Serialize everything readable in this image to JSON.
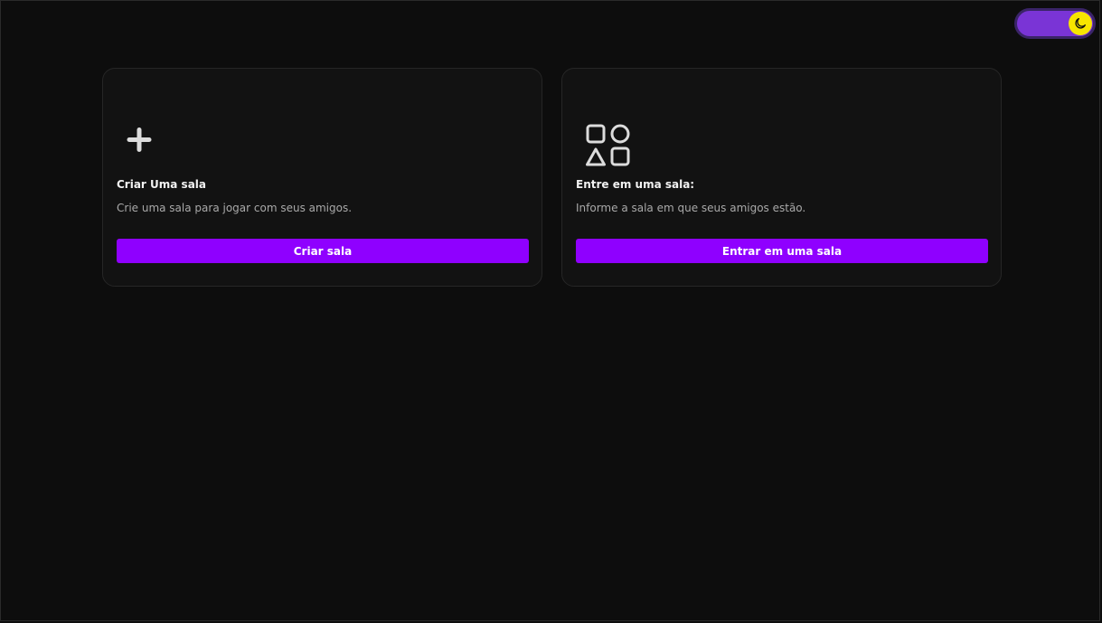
{
  "theme_toggle": {
    "icon": "moon-icon",
    "state": "dark",
    "track_color": "#7a34d6",
    "knob_color": "#f7e500"
  },
  "cards": [
    {
      "icon": "plus-icon",
      "title": "Criar Uma sala",
      "description": "Crie uma sala para jogar com seus amigos.",
      "button_label": "Criar sala"
    },
    {
      "icon": "shapes-icon",
      "title": "Entre em uma sala:",
      "description": "Informe a sala em que seus amigos estão.",
      "button_label": "Entrar em uma sala"
    }
  ],
  "colors": {
    "background": "#0d0d0d",
    "card_background": "#121212",
    "accent": "#8f00ff"
  }
}
